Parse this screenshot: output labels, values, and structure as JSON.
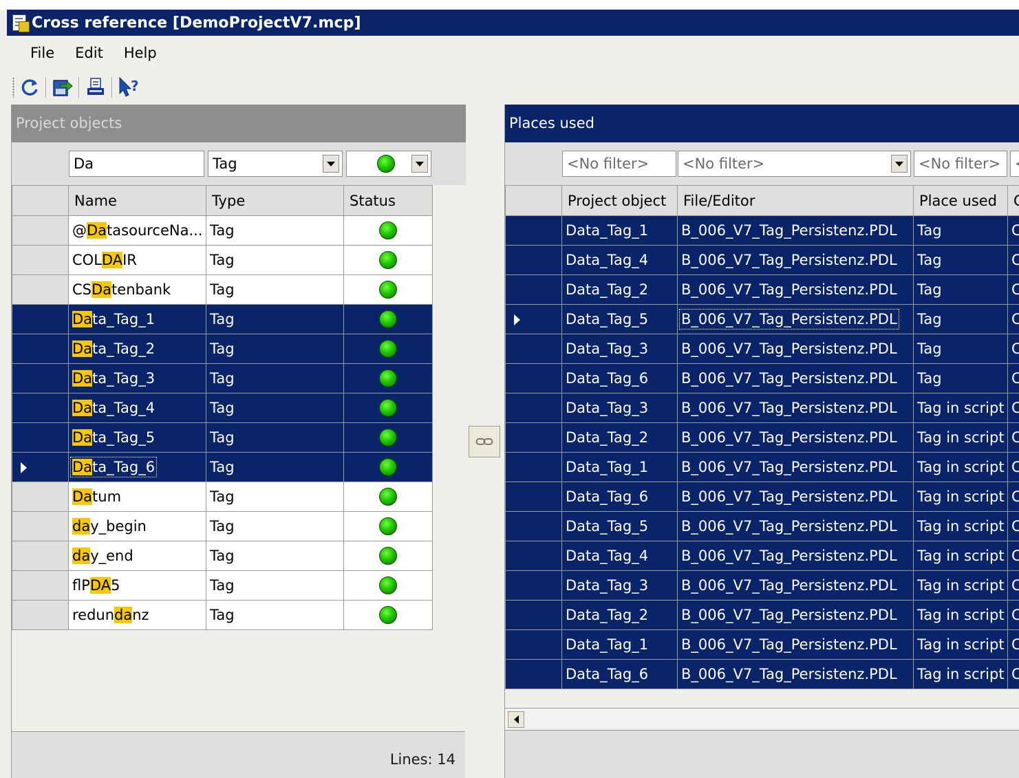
{
  "window": {
    "title": "Cross reference [DemoProjectV7.mcp]"
  },
  "menu": [
    "File",
    "Edit",
    "Help"
  ],
  "toolbar": {
    "icons": [
      "refresh-icon",
      "export-icon",
      "print-icon",
      "help-pointer-icon"
    ]
  },
  "left_panel": {
    "title": "Project objects",
    "filters": {
      "name": "Da",
      "type": "Tag",
      "status": "green"
    },
    "columns": [
      "Name",
      "Type",
      "Status"
    ],
    "rows": [
      {
        "pre": "@",
        "hl": "Da",
        "post": "tasourceNa...",
        "type": "Tag",
        "selected": false
      },
      {
        "pre": "COL",
        "hl": "DA",
        "post": "IR",
        "type": "Tag",
        "selected": false
      },
      {
        "pre": "CS",
        "hl": "Da",
        "post": "tenbank",
        "type": "Tag",
        "selected": false
      },
      {
        "pre": "",
        "hl": "Da",
        "post": "ta_Tag_1",
        "type": "Tag",
        "selected": true
      },
      {
        "pre": "",
        "hl": "Da",
        "post": "ta_Tag_2",
        "type": "Tag",
        "selected": true
      },
      {
        "pre": "",
        "hl": "Da",
        "post": "ta_Tag_3",
        "type": "Tag",
        "selected": true
      },
      {
        "pre": "",
        "hl": "Da",
        "post": "ta_Tag_4",
        "type": "Tag",
        "selected": true
      },
      {
        "pre": "",
        "hl": "Da",
        "post": "ta_Tag_5",
        "type": "Tag",
        "selected": true
      },
      {
        "pre": "",
        "hl": "Da",
        "post": "ta_Tag_6",
        "type": "Tag",
        "selected": true,
        "current": true
      },
      {
        "pre": "",
        "hl": "Da",
        "post": "tum",
        "type": "Tag",
        "selected": false
      },
      {
        "pre": "",
        "hl": "da",
        "post": "y_begin",
        "type": "Tag",
        "selected": false
      },
      {
        "pre": "",
        "hl": "da",
        "post": "y_end",
        "type": "Tag",
        "selected": false
      },
      {
        "pre": "flP",
        "hl": "DA",
        "post": "5",
        "type": "Tag",
        "selected": false
      },
      {
        "pre": "redun",
        "hl": "da",
        "post": "nz",
        "type": "Tag",
        "selected": false
      }
    ],
    "footer": "Lines: 14"
  },
  "right_panel": {
    "title": "Places used",
    "filters": [
      "<No filter>",
      "<No filter>",
      "<No filter>",
      "<"
    ],
    "columns": [
      "Project object",
      "File/Editor",
      "Place used",
      "C"
    ],
    "rows": [
      {
        "object": "Data_Tag_1",
        "file": "B_006_V7_Tag_Persistenz.PDL",
        "place": "Tag",
        "extra": "C"
      },
      {
        "object": "Data_Tag_4",
        "file": "B_006_V7_Tag_Persistenz.PDL",
        "place": "Tag",
        "extra": "C"
      },
      {
        "object": "Data_Tag_2",
        "file": "B_006_V7_Tag_Persistenz.PDL",
        "place": "Tag",
        "extra": "C"
      },
      {
        "object": "Data_Tag_5",
        "file": "B_006_V7_Tag_Persistenz.PDL",
        "place": "Tag",
        "extra": "C",
        "current": true
      },
      {
        "object": "Data_Tag_3",
        "file": "B_006_V7_Tag_Persistenz.PDL",
        "place": "Tag",
        "extra": "C"
      },
      {
        "object": "Data_Tag_6",
        "file": "B_006_V7_Tag_Persistenz.PDL",
        "place": "Tag",
        "extra": "C"
      },
      {
        "object": "Data_Tag_3",
        "file": "B_006_V7_Tag_Persistenz.PDL",
        "place": "Tag in script",
        "extra": "C"
      },
      {
        "object": "Data_Tag_2",
        "file": "B_006_V7_Tag_Persistenz.PDL",
        "place": "Tag in script",
        "extra": "C"
      },
      {
        "object": "Data_Tag_1",
        "file": "B_006_V7_Tag_Persistenz.PDL",
        "place": "Tag in script",
        "extra": "C"
      },
      {
        "object": "Data_Tag_6",
        "file": "B_006_V7_Tag_Persistenz.PDL",
        "place": "Tag in script",
        "extra": "C"
      },
      {
        "object": "Data_Tag_5",
        "file": "B_006_V7_Tag_Persistenz.PDL",
        "place": "Tag in script",
        "extra": "C"
      },
      {
        "object": "Data_Tag_4",
        "file": "B_006_V7_Tag_Persistenz.PDL",
        "place": "Tag in script",
        "extra": "C"
      },
      {
        "object": "Data_Tag_3",
        "file": "B_006_V7_Tag_Persistenz.PDL",
        "place": "Tag in script",
        "extra": "C"
      },
      {
        "object": "Data_Tag_2",
        "file": "B_006_V7_Tag_Persistenz.PDL",
        "place": "Tag in script",
        "extra": "C"
      },
      {
        "object": "Data_Tag_1",
        "file": "B_006_V7_Tag_Persistenz.PDL",
        "place": "Tag in script",
        "extra": "C"
      },
      {
        "object": "Data_Tag_6",
        "file": "B_006_V7_Tag_Persistenz.PDL",
        "place": "Tag in script",
        "extra": "C"
      }
    ]
  },
  "colors": {
    "selection": "#0a246a",
    "highlight": "#f7c800",
    "status_ok": "#21c400"
  }
}
